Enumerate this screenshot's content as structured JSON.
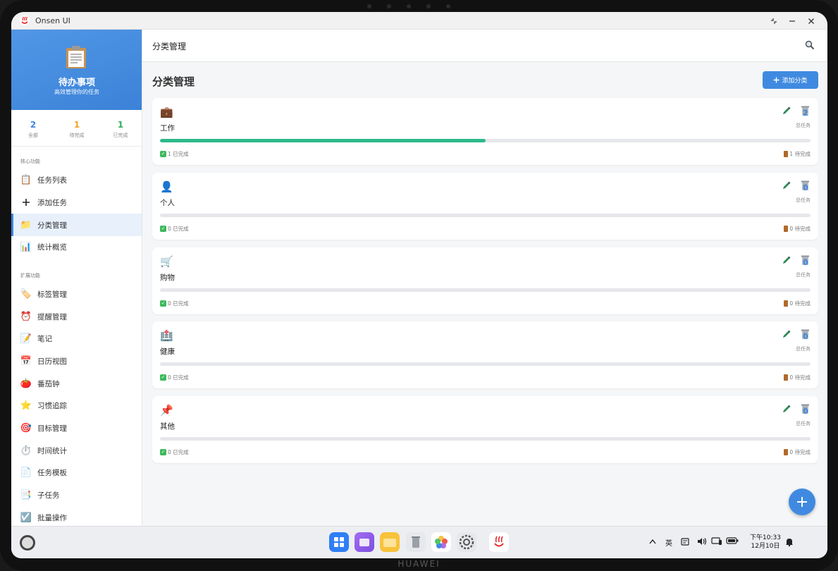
{
  "window": {
    "title": "Onsen UI"
  },
  "sidebar": {
    "app_title": "待办事项",
    "app_subtitle": "高效管理你的任务",
    "stats": [
      {
        "value": "2",
        "label": "全部",
        "color": "#3d86dd"
      },
      {
        "value": "1",
        "label": "待完成",
        "color": "#f0a427"
      },
      {
        "value": "1",
        "label": "已完成",
        "color": "#2fae5d"
      }
    ],
    "sections": [
      "核心功能",
      "扩展功能"
    ],
    "core_items": [
      {
        "icon": "clipboard-icon",
        "label": "任务列表"
      },
      {
        "icon": "plus-icon",
        "label": "添加任务"
      },
      {
        "icon": "folder-icon",
        "label": "分类管理",
        "active": true
      },
      {
        "icon": "bar-chart-icon",
        "label": "统计概览"
      }
    ],
    "ext_items": [
      {
        "icon": "tag-icon",
        "label": "标签管理"
      },
      {
        "icon": "alarm-clock-icon",
        "label": "提醒管理"
      },
      {
        "icon": "memo-icon",
        "label": "笔记"
      },
      {
        "icon": "calendar-icon",
        "label": "日历视图"
      },
      {
        "icon": "tomato-icon",
        "label": "番茄钟"
      },
      {
        "icon": "star-icon",
        "label": "习惯追踪"
      },
      {
        "icon": "target-icon",
        "label": "目标管理"
      },
      {
        "icon": "stopwatch-icon",
        "label": "时间统计"
      },
      {
        "icon": "document-icon",
        "label": "任务模板"
      },
      {
        "icon": "subtask-icon",
        "label": "子任务"
      },
      {
        "icon": "checkbox-icon",
        "label": "批量操作"
      }
    ]
  },
  "toolbar": {
    "title": "分类管理"
  },
  "main": {
    "title": "分类管理",
    "add_button": "添加分类",
    "total_label": "总任务",
    "categories": [
      {
        "icon": "briefcase-icon",
        "name": "工作",
        "total": "2",
        "progress": 0.5,
        "done": "1 已完成",
        "pending": "1 待完成"
      },
      {
        "icon": "person-icon",
        "name": "个人",
        "total": "0",
        "progress": 0,
        "done": "0 已完成",
        "pending": "0 待完成"
      },
      {
        "icon": "cart-icon",
        "name": "购物",
        "total": "0",
        "progress": 0,
        "done": "0 已完成",
        "pending": "0 待完成"
      },
      {
        "icon": "hospital-icon",
        "name": "健康",
        "total": "0",
        "progress": 0,
        "done": "0 已完成",
        "pending": "0 待完成"
      },
      {
        "icon": "pushpin-icon",
        "name": "其他",
        "total": "0",
        "progress": 0,
        "done": "0 已完成",
        "pending": "0 待完成"
      }
    ]
  },
  "taskbar": {
    "dock": [
      "grid-app-icon",
      "multitask-icon",
      "files-icon",
      "trash-icon",
      "gallery-icon",
      "settings-icon",
      "onsen-app-icon"
    ],
    "ime": "英",
    "time": "下午10:33",
    "date": "12月10日"
  },
  "device": {
    "brand": "HUAWEI"
  }
}
